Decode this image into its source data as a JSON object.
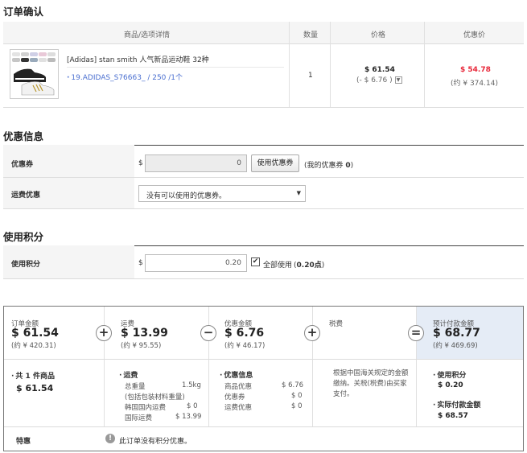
{
  "order_confirm": {
    "title": "订单确认",
    "headers": {
      "product": "商品/选项详情",
      "qty": "数量",
      "price": "价格",
      "discount_price": "优惠价"
    },
    "item": {
      "name": "[Adidas] stan smith 人气新品运动鞋 32种",
      "option": "19.ADIDAS_S76663_ / 250 /1个",
      "qty": "1",
      "price": "$ 61.54",
      "price_discount": "(- $ 6.76 )",
      "discount_price": "$ 54.78",
      "discount_price_cny": "(约 ¥ 374.14)"
    }
  },
  "promo": {
    "title": "优惠信息",
    "coupon_label": "优惠券",
    "coupon_currency": "$",
    "coupon_value": "0",
    "coupon_button": "使用优惠券",
    "my_coupon_prefix": "(我的优惠券 ",
    "my_coupon_count": "0",
    "my_coupon_suffix": ")",
    "shipping_label": "运费优惠",
    "shipping_select": "没有可以使用的优惠券。"
  },
  "points": {
    "title": "使用积分",
    "label": "使用积分",
    "currency": "$",
    "value": "0.20",
    "use_all_label": "全部使用",
    "available_prefix": "(",
    "available_value": "0.20点",
    "available_suffix": ")"
  },
  "summary": {
    "order_total_label": "订单金额",
    "order_total": "$ 61.54",
    "order_total_cny": "(约 ¥ 420.31)",
    "shipping_label": "运费",
    "shipping": "$ 13.99",
    "shipping_cny": "(约 ¥ 95.55)",
    "discount_label": "优惠金额",
    "discount": "$ 6.76",
    "discount_cny": "(约 ¥ 46.17)",
    "tax_label": "税费",
    "payment_label": "预计付款金额",
    "payment": "$ 68.77",
    "payment_cny": "(约 ¥ 469.69)",
    "ops": {
      "plus1": "+",
      "minus": "−",
      "plus2": "+",
      "equals": "="
    }
  },
  "detail": {
    "goods_title": "共 1 件商品",
    "goods_amount": "$ 61.54",
    "shipping_title": "运费",
    "total_weight_label": "总重量",
    "total_weight": "1.5kg",
    "weight_note": "(包括包装材料重量)",
    "domestic_label": "韩国国内运费",
    "domestic": "$ 0",
    "intl_label": "国际运费",
    "intl": "$ 13.99",
    "discount_title": "优惠信息",
    "product_discount_label": "商品优惠",
    "product_discount": "$ 6.76",
    "coupon_discount_label": "优惠券",
    "coupon_discount": "$ 0",
    "shipping_discount_label": "运费优惠",
    "shipping_discount": "$ 0",
    "tax_note": "根据中国海关规定的金额缴纳。关税(税费)由买家支付。",
    "points_title": "使用积分",
    "points_value": "$ 0.20",
    "actual_title": "实际付款金额",
    "actual_value": "$ 68.57"
  },
  "special": {
    "label": "特惠",
    "note": "此订单没有积分优惠。"
  },
  "icons": {
    "info": "info-icon",
    "dropdown": "chevron-down-icon",
    "check": "check-icon"
  }
}
